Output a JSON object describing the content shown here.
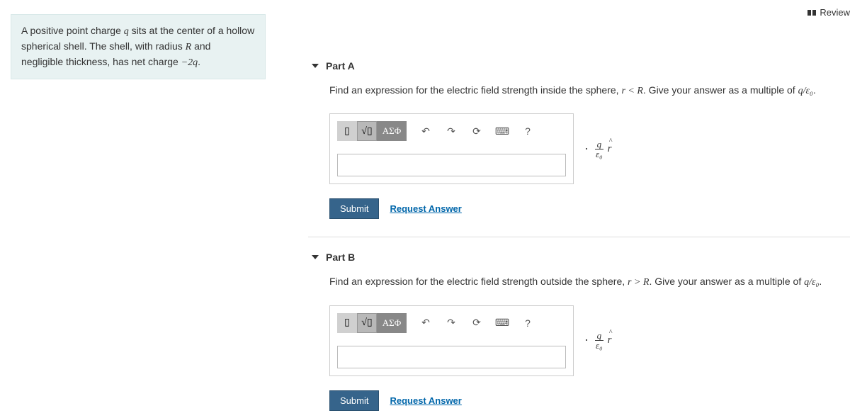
{
  "topbar": {
    "review_label": "Review"
  },
  "problem": {
    "text_parts": [
      "A positive point charge ",
      "q",
      " sits at the center of a hollow spherical shell. The shell, with radius ",
      "R",
      " and negligible thickness, has net charge ",
      "−2q",
      "."
    ]
  },
  "parts": {
    "a": {
      "title": "Part A",
      "prompt_before": "Find an expression for the electric field strength inside the sphere, ",
      "prompt_cond": "r < R",
      "prompt_mid": ". Give your answer as a multiple of ",
      "prompt_unit": "q/ε₀",
      "prompt_after": "."
    },
    "b": {
      "title": "Part B",
      "prompt_before": "Find an expression for the electric field strength outside the sphere, ",
      "prompt_cond": "r > R",
      "prompt_mid": ". Give your answer as a multiple of ",
      "prompt_unit": "q/ε₀",
      "prompt_after": "."
    }
  },
  "toolbar": {
    "templates_label": "▯",
    "sqrt_label": "√▯",
    "greek_label": "ΑΣΦ",
    "undo_label": "↶",
    "redo_label": "↷",
    "reset_label": "⟳",
    "keyboard_label": "⌨",
    "help_label": "?"
  },
  "unit": {
    "num": "q",
    "den": "ε₀",
    "rhat": "r"
  },
  "actions": {
    "submit": "Submit",
    "request": "Request Answer"
  }
}
